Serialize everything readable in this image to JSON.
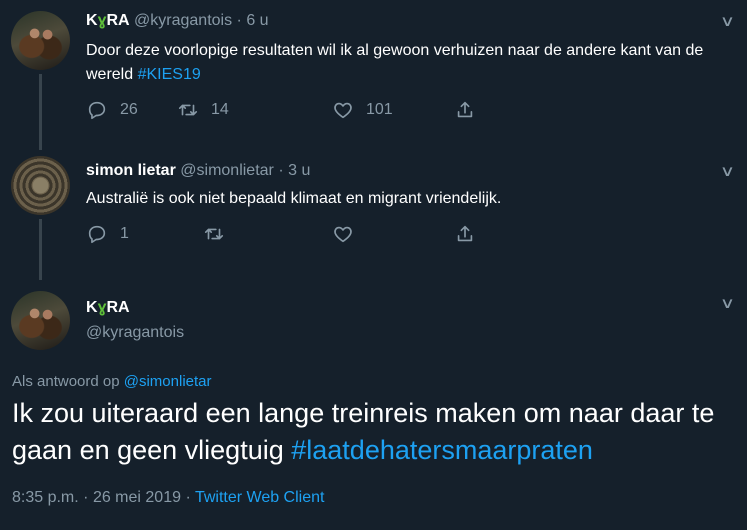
{
  "tweet1": {
    "name_k": "K",
    "name_ra": "RA",
    "handle": "@kyragantois",
    "time": "6 u",
    "text": "Door deze voorlopige resultaten wil ik al gewoon verhuizen naar de andere kant van de wereld",
    "hashtag": "#KIES19",
    "replies": "26",
    "retweets": "14",
    "likes": "101"
  },
  "tweet2": {
    "name": "simon lietar",
    "handle": "@simonlietar",
    "time": "3 u",
    "text": "Australië is ook niet bepaald klimaat en migrant vriendelijk.",
    "replies": "1"
  },
  "main": {
    "name_k": "K",
    "name_ra": "RA",
    "handle": "@kyragantois",
    "reply_prefix": "Als antwoord op",
    "reply_handle": "@simonlietar",
    "text": "Ik zou uiteraard een lange treinreis maken om naar daar te gaan en geen vliegtuig",
    "hashtag": "#laatdehatersmaarpraten",
    "time": "8:35 p.m.",
    "date": "26 mei 2019",
    "client": "Twitter Web Client"
  },
  "icons": [
    "reply-icon",
    "retweet-icon",
    "like-icon",
    "share-icon",
    "chevron-down-icon",
    "sprout-icon"
  ],
  "colors": {
    "background": "#15202b",
    "accent": "#1da1f2",
    "muted": "#8899a6",
    "divider": "#38444d"
  }
}
